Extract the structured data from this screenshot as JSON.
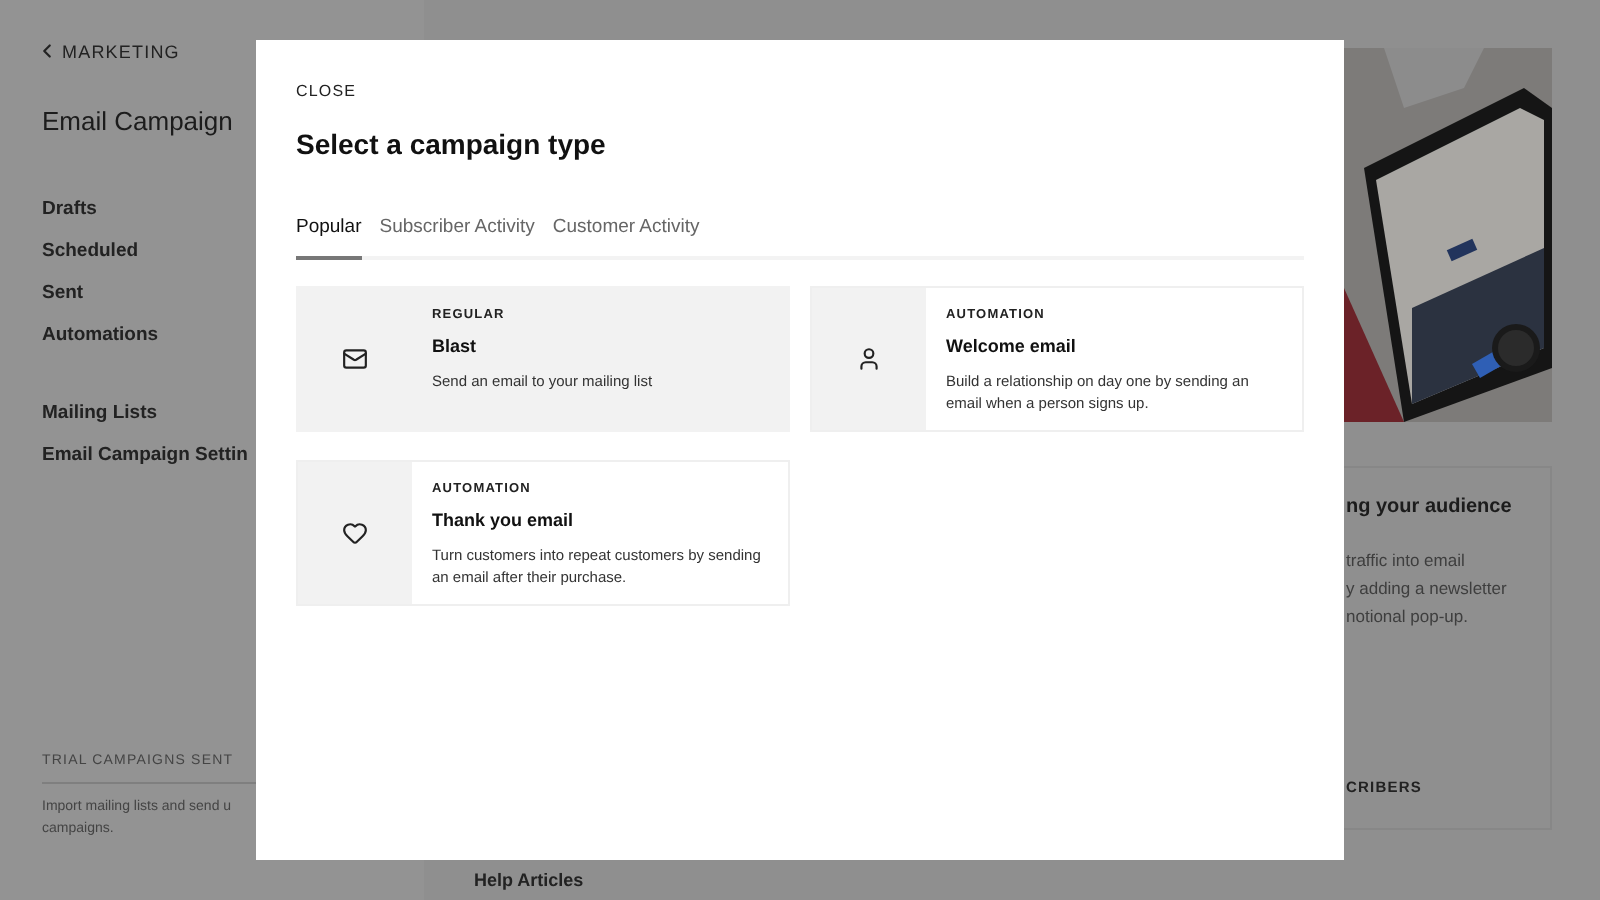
{
  "sidebar": {
    "back_link": "MARKETING",
    "title": "Email Campaign",
    "items": [
      "Drafts",
      "Scheduled",
      "Sent",
      "Automations"
    ],
    "secondary_items": [
      "Mailing Lists",
      "Email Campaign Settin"
    ],
    "footer": {
      "label": "TRIAL CAMPAIGNS SENT",
      "lines": [
        "Import mailing lists and send u",
        "campaigns."
      ]
    }
  },
  "content": {
    "promo_card": {
      "title": "ng your audience",
      "lines": [
        "traffic into email",
        "y adding a newsletter",
        "notional pop-up."
      ],
      "action": "CRIBERS"
    },
    "help_heading": "Help Articles"
  },
  "modal": {
    "close": "CLOSE",
    "title": "Select a campaign type",
    "tabs": [
      {
        "label": "Popular",
        "selected": true
      },
      {
        "label": "Subscriber Activity",
        "selected": false
      },
      {
        "label": "Customer Activity",
        "selected": false
      }
    ],
    "options": [
      {
        "category": "REGULAR",
        "title": "Blast",
        "description": "Send an email to your mailing list",
        "selected": true
      },
      {
        "category": "AUTOMATION",
        "title": "Welcome email",
        "description": "Build a relationship on day one by sending an email when a person signs up.",
        "selected": false
      },
      {
        "category": "AUTOMATION",
        "title": "Thank you email",
        "description": "Turn customers into repeat customers by sending an email after their purchase.",
        "selected": false
      }
    ]
  }
}
